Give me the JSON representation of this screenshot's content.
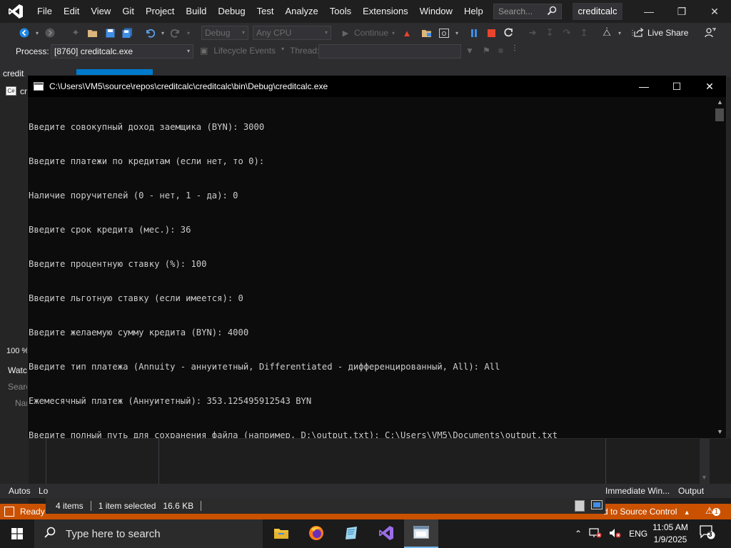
{
  "vs": {
    "menu": [
      "File",
      "Edit",
      "View",
      "Git",
      "Project",
      "Build",
      "Debug",
      "Test",
      "Analyze",
      "Tools",
      "Extensions",
      "Window",
      "Help"
    ],
    "search_placeholder": "Search...",
    "solution_name": "creditcalc",
    "toolbar": {
      "config": "Debug",
      "platform": "Any CPU",
      "continue_label": "Continue",
      "live_share": "Live Share"
    },
    "process_label": "Process:",
    "process_value": "[8760] creditcalc.exe",
    "lifecycle_label": "Lifecycle Events",
    "thread_label": "Thread:",
    "doc_tab_partial": "credit",
    "left_panel_partial": "cr",
    "zoom": "100 %",
    "watch_partial": "Watc",
    "search_partial": "Searc",
    "name_partial": "Nar",
    "bottom_tabs": {
      "autos": "Autos",
      "locals_partial": "Lo",
      "immediate": "Immediate Win...",
      "output": "Output"
    },
    "status": {
      "ready": "Ready",
      "source_control": "d to Source Control",
      "notifications": "1"
    }
  },
  "explorer_status": {
    "items": "4 items",
    "selected": "1 item selected",
    "size": "16.6 KB"
  },
  "console": {
    "title": "C:\\Users\\VM5\\source\\repos\\creditcalc\\creditcalc\\bin\\Debug\\creditcalc.exe",
    "lines": [
      "Введите совокупный доход заемщика (BYN): 3000",
      "Введите платежи по кредитам (если нет, то 0):",
      "Наличие поручителей (0 - нет, 1 - да): 0",
      "Введите срок кредита (мес.): 36",
      "Введите процентную ставку (%): 100",
      "Введите льготную ставку (если имеется): 0",
      "Введите желаемую сумму кредита (BYN): 4000",
      "Введите тип платежа (Annuity - аннуитетный, Differentiated - дифференцированный, All): All",
      "Ежемесячный платеж (Аннуитетный): 353.125495912543 BYN",
      "Введите полный путь для сохранения файла (например, D:\\output.txt): C:\\Users\\VM5\\Documents\\output.txt"
    ]
  },
  "taskbar": {
    "search_placeholder": "Type here to search",
    "language": "ENG",
    "time": "11:05 AM",
    "date": "1/9/2025",
    "notification_count": "3"
  }
}
